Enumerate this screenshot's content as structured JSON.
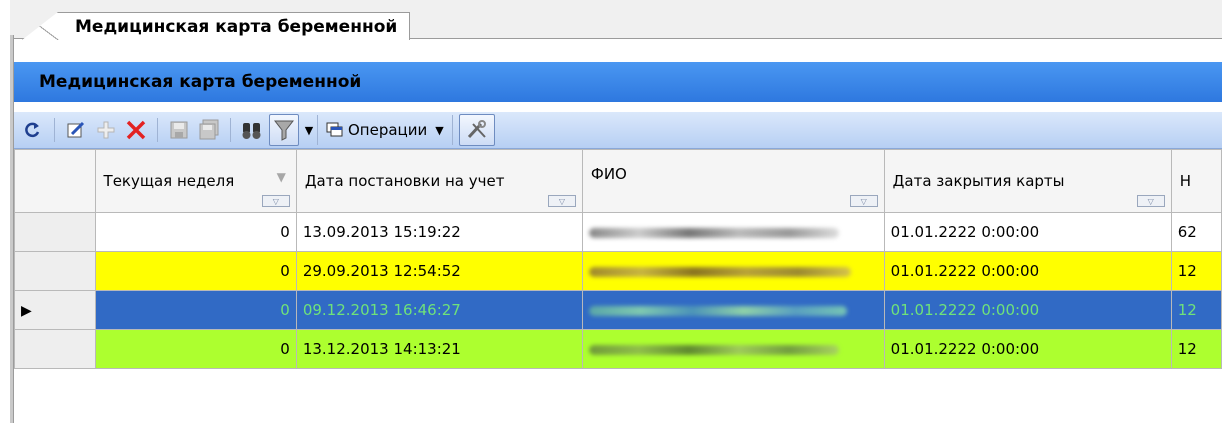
{
  "tab": {
    "label": "Медицинская карта беременной"
  },
  "panel": {
    "title": "Медицинская карта беременной"
  },
  "toolbar": {
    "operations_label": "Операции",
    "icons": [
      "refresh-icon",
      "edit-icon",
      "add-icon",
      "delete-icon",
      "save-icon",
      "save-all-icon",
      "find-icon",
      "filter-icon",
      "operations-icon",
      "tools-icon"
    ]
  },
  "grid": {
    "columns": [
      "Текущая неделя",
      "Дата постановки на учет",
      "ФИО",
      "Дата закрытия карты",
      "Н"
    ],
    "rows": [
      {
        "week": "0",
        "date_reg": "13.09.2013 15:19:22",
        "date_close": "01.01.2222 0:00:00",
        "n": "62",
        "color": "#ffffff"
      },
      {
        "week": "0",
        "date_reg": "29.09.2013 12:54:52",
        "date_close": "01.01.2222 0:00:00",
        "n": "12",
        "color": "#ffff00"
      },
      {
        "week": "0",
        "date_reg": "09.12.2013 16:46:27",
        "date_close": "01.01.2222 0:00:00",
        "n": "12",
        "color": "#316ac5",
        "selected": true
      },
      {
        "week": "0",
        "date_reg": "13.12.2013 14:13:21",
        "date_close": "01.01.2222 0:00:00",
        "n": "12",
        "color": "#adff2f"
      }
    ]
  }
}
